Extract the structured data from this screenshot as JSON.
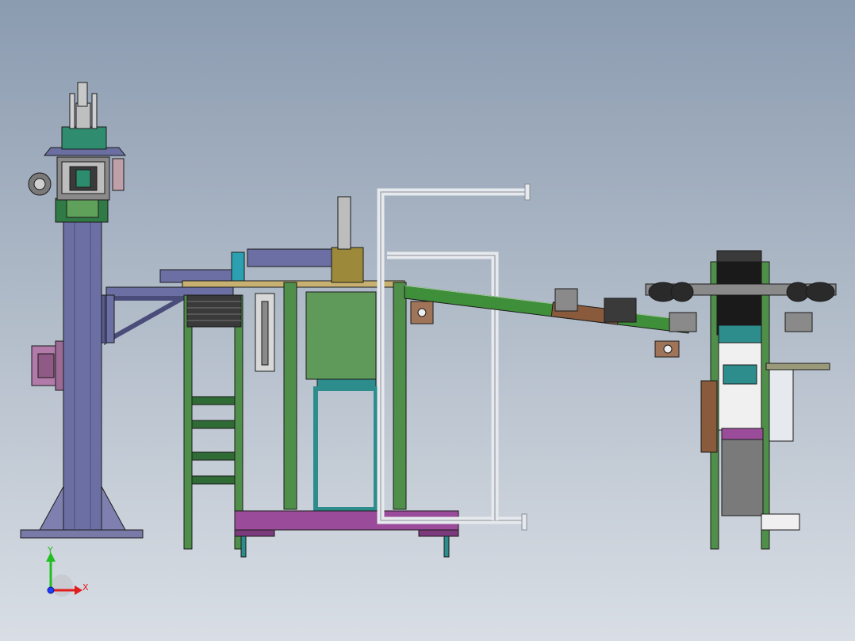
{
  "viewport": {
    "background_top": "#8b9bb0",
    "background_bottom": "#d9dee5"
  },
  "triad": {
    "y_label": "Y",
    "x_label": "X",
    "y_color": "#1fbf1f",
    "x_color": "#e01c1c",
    "z_color": "#1e3cff"
  },
  "colors": {
    "frame_green": "#4f8f4a",
    "frame_dark_green": "#2f6b35",
    "column_purple": "#6c6fa3",
    "base_purple": "#9a4c9a",
    "teal": "#2d8c8c",
    "conveyor_green": "#3f8f3a",
    "white_frame": "#e6e9ed",
    "brown": "#8a5a3c",
    "dark": "#1a1a1a"
  }
}
